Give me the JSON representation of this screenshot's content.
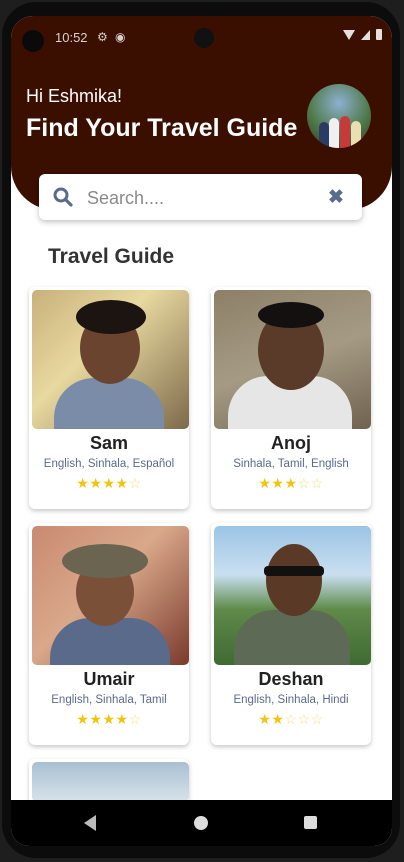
{
  "status": {
    "time": "10:52"
  },
  "header": {
    "greeting": "Hi Eshmika!",
    "title": "Find Your Travel Guide"
  },
  "search": {
    "placeholder": "Search...."
  },
  "section": {
    "title": "Travel Guide"
  },
  "guides": [
    {
      "name": "Sam",
      "languages": "English, Sinhala, Español",
      "rating": 4,
      "stars": "★★★★☆"
    },
    {
      "name": "Anoj",
      "languages": "Sinhala, Tamil, English",
      "rating": 3,
      "stars": "★★★☆☆"
    },
    {
      "name": "Umair",
      "languages": "English, Sinhala, Tamil",
      "rating": 4,
      "stars": "★★★★☆"
    },
    {
      "name": "Deshan",
      "languages": "English, Sinhala, Hindi",
      "rating": 2,
      "stars": "★★☆☆☆"
    }
  ],
  "colors": {
    "header_bg": "#3b0f00",
    "star": "#f1c40f",
    "accent_icon": "#5a6b8c"
  },
  "icons": {
    "search": "search-icon",
    "clear": "clear-icon"
  }
}
